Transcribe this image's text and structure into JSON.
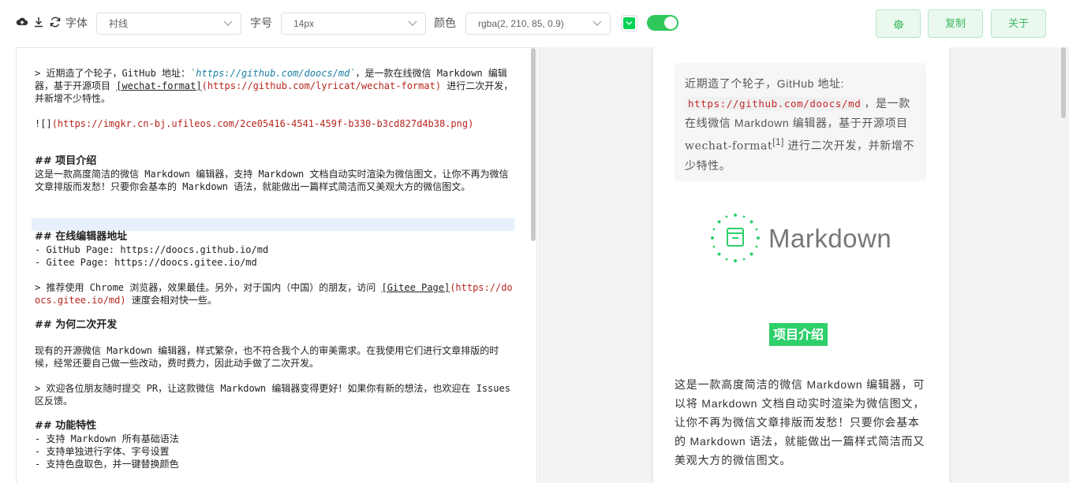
{
  "toolbar": {
    "font_label": "字体",
    "font_value": "衬线",
    "size_label": "字号",
    "size_value": "14px",
    "color_label": "颜色",
    "color_value": "rgba(2, 210, 85, 0.9)",
    "copy_label": "复制",
    "about_label": "关于"
  },
  "accent_color": "#02d255",
  "editor": {
    "lines": {
      "l1a": "> 近期造了个轮子，GitHub 地址：",
      "l1b": "`https://github.com/doocs/md`",
      "l1c": "，是一款在线微信 Markdown 编辑器，基于开源项目 ",
      "l1d": "[wechat-format]",
      "l1e": "(https://github.com/lyricat/wechat-format)",
      "l1f": " 进行二次开发，并新增不少特性。",
      "l2a": "![]",
      "l2b": "(https://imgkr.cn-bj.ufileos.com/2ce05416-4541-459f-b330-b3cd827d4b38.png)",
      "h1": "## 项目介绍",
      "p1": "这是一款高度简洁的微信 Markdown 编辑器，支持 Markdown 文档自动实时渲染为微信图文，让你不再为微信文章排版而发愁！只要你会基本的 Markdown 语法，就能做出一篇样式简洁而又美观大方的微信图文。",
      "h2": "## 在线编辑器地址",
      "li1": "- GitHub Page: https://doocs.github.io/md",
      "li2": "- Gitee Page: https://doocs.gitee.io/md",
      "q2a": "> 推荐使用 Chrome 浏览器，效果最佳。另外，对于国内（中国）的朋友，访问 ",
      "q2b": "[Gitee Page]",
      "q2c": "(https://doocs.gitee.io/md)",
      "q2d": " 速度会相对快一些。",
      "h3": "## 为何二次开发",
      "p2": "现有的开源微信 Markdown 编辑器，样式繁杂，也不符合我个人的审美需求。在我使用它们进行文章排版的时候，经常还要自己做一些改动，费时费力，因此动手做了二次开发。",
      "q3": "> 欢迎各位朋友随时提交 PR，让这款微信 Markdown 编辑器变得更好！如果你有新的想法，也欢迎在 Issues 区反馈。",
      "h4": "## 功能特性",
      "f1": "- 支持 Markdown 所有基础语法",
      "f2": "- 支持单独进行字体、字号设置",
      "f3": "- 支持色盘取色，并一键替换颜色"
    }
  },
  "preview": {
    "quote_a": "近期造了个轮子，GitHub 地址:",
    "quote_code": "https://github.com/doocs/md",
    "quote_b": "，是一款在线微信 Markdown 编辑器，基于开源项目",
    "quote_link": "wechat-format",
    "quote_sup": "[1]",
    "quote_c": "进行二次开发，并新增不少特性。",
    "logo_text": "Markdown",
    "heading": "项目介绍",
    "paragraph": "这是一款高度简洁的微信 Markdown 编辑器，可以将 Markdown 文档自动实时渲染为微信图文，让你不再为微信文章排版而发愁！只要你会基本的 Markdown 语法，就能做出一篇样式简洁而又美观大方的微信图文。"
  }
}
